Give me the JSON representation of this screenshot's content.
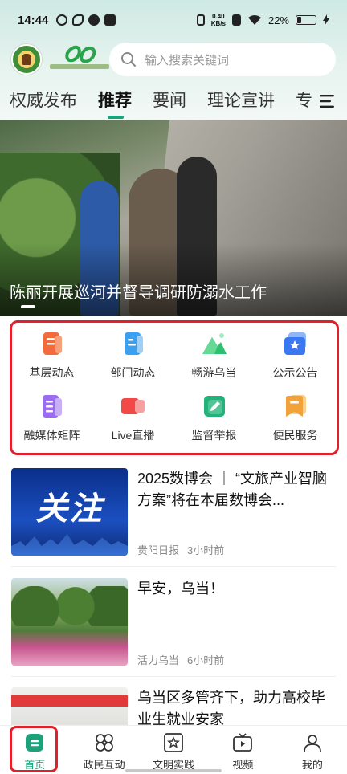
{
  "status_bar": {
    "time": "14:44",
    "net_speed_value": "0.40",
    "net_speed_unit": "KB/s",
    "battery": "22%"
  },
  "header": {
    "search_placeholder": "输入搜索关键词"
  },
  "tabs": [
    "权威发布",
    "推荐",
    "要闻",
    "理论宣讲"
  ],
  "tab_partial": "专",
  "active_tab_index": 1,
  "banner": {
    "title": "陈丽开展巡河并督导调研防溺水工作"
  },
  "quick_grid": [
    {
      "label": "基层动态",
      "icon": "news-doc-icon",
      "color": "#f26b3a"
    },
    {
      "label": "部门动态",
      "icon": "department-doc-icon",
      "color": "#3aa0f2"
    },
    {
      "label": "畅游乌当",
      "icon": "mountain-icon",
      "color": "#2fbf71"
    },
    {
      "label": "公示公告",
      "icon": "announcement-icon",
      "color": "#3a78f2"
    },
    {
      "label": "融媒体矩阵",
      "icon": "media-matrix-icon",
      "color": "#9b6bf2"
    },
    {
      "label": "Live直播",
      "icon": "live-video-icon",
      "color": "#f24848"
    },
    {
      "label": "监督举报",
      "icon": "report-pen-icon",
      "color": "#23b27a"
    },
    {
      "label": "便民服务",
      "icon": "service-bookmark-icon",
      "color": "#f2a23a"
    }
  ],
  "news": [
    {
      "title": "2025数博会 ｜ “文旅产业智脑方案”将在本届数博会...",
      "source": "贵阳日报",
      "time": "3小时前",
      "thumb_text": "关注"
    },
    {
      "title": "早安，乌当！",
      "source": "活力乌当",
      "time": "6小时前"
    },
    {
      "title": "乌当区多管齐下，助力高校毕业生就业安家",
      "source": "",
      "time": ""
    }
  ],
  "bottom_nav": [
    {
      "label": "首页",
      "icon": "home-icon",
      "active": true
    },
    {
      "label": "政民互动",
      "icon": "interaction-icon",
      "active": false
    },
    {
      "label": "文明实践",
      "icon": "civilization-star-icon",
      "active": false
    },
    {
      "label": "视频",
      "icon": "video-icon",
      "active": false
    },
    {
      "label": "我的",
      "icon": "profile-icon",
      "active": false
    }
  ],
  "colors": {
    "accent": "#1aa37a",
    "highlight_border": "#e0202a"
  }
}
